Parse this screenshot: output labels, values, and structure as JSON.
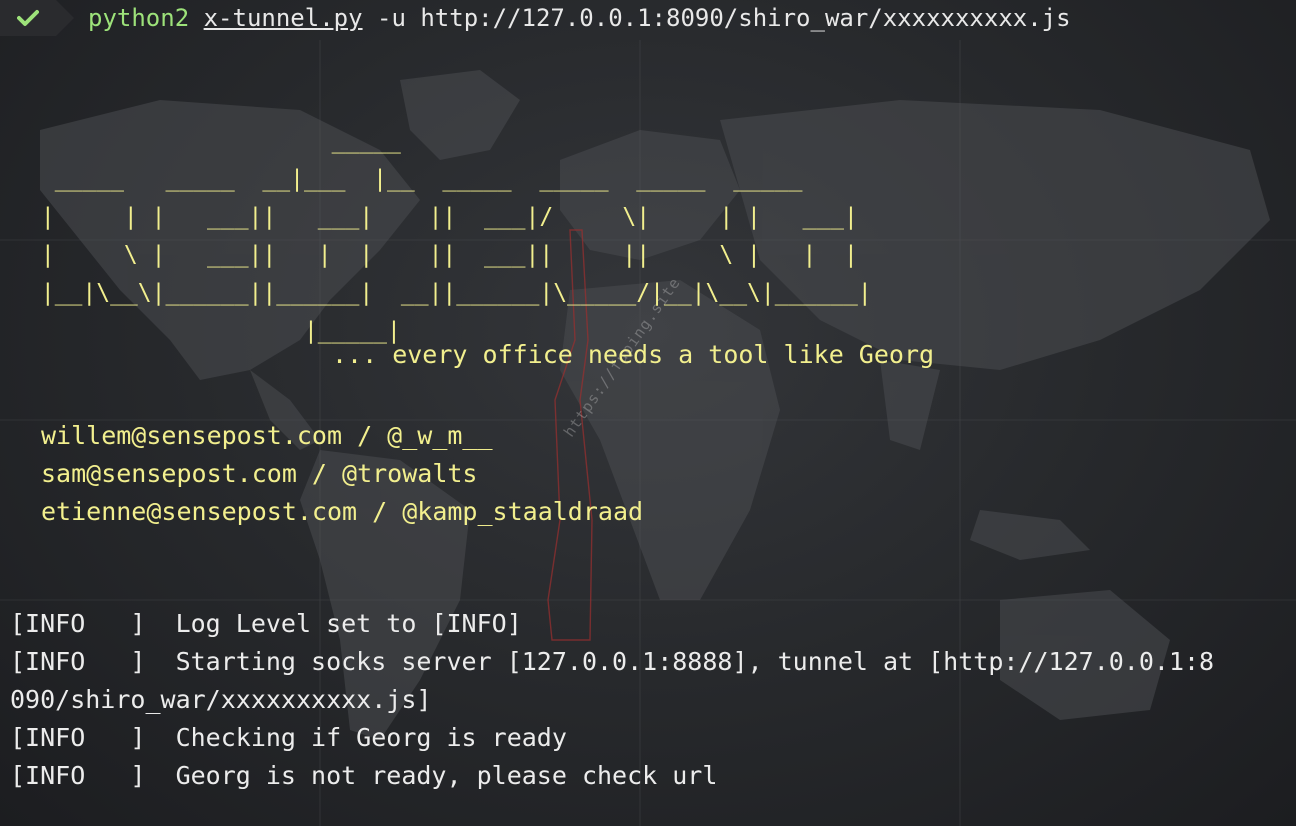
{
  "prompt": {
    "status_icon": "check-icon",
    "program": "python2",
    "script": "x-tunnel.py",
    "args": " -u http://127.0.0.1:8090/shiro_war/xxxxxxxxxx.js"
  },
  "banner": {
    "ascii_art": "                      _____\n  _____   _____  __|___  |__  _____  _____  _____  _____\n |     | |   ___||   ___|    ||  ___|/     \\|     | |   ___|\n |     \\ |   ___||   |  |    ||  ___||     ||     \\ |   |  |\n |__|\\__\\|______||______|  __||______|\\_____/|__|\\__\\|______|\n                    |_____|",
    "tagline": "... every office needs a tool like Georg",
    "contacts": [
      "willem@sensepost.com / @_w_m__",
      "sam@sensepost.com / @trowalts",
      "etienne@sensepost.com / @kamp_staaldraad"
    ]
  },
  "watermark": "https://fuping.site",
  "log": [
    "[INFO   ]  Log Level set to [INFO]",
    "[INFO   ]  Starting socks server [127.0.0.1:8888], tunnel at [http://127.0.0.1:8",
    "090/shiro_war/xxxxxxxxxx.js]",
    "[INFO   ]  Checking if Georg is ready",
    "[INFO   ]  Georg is not ready, please check url"
  ],
  "colors": {
    "banner": "#f2ef8e",
    "prompt_green": "#9de27a",
    "log_text": "#ececec",
    "background": "#27292c"
  }
}
